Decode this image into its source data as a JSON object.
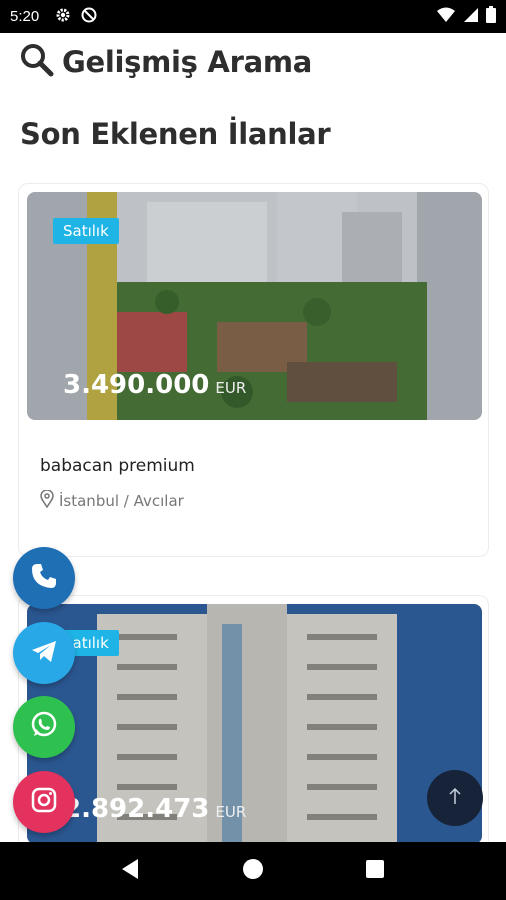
{
  "status_bar": {
    "time": "5:20",
    "left_icons": [
      "gear-icon",
      "do-not-disturb-icon"
    ],
    "right_icons": [
      "wifi-icon",
      "cell-signal-icon",
      "battery-icon"
    ]
  },
  "search": {
    "label": "Gelişmiş Arama",
    "icon": "search-icon"
  },
  "section": {
    "title": "Son Eklenen İlanlar"
  },
  "listings": [
    {
      "badge": "Satılık",
      "price": "3.490.000",
      "currency": "EUR",
      "title": "babacan premium",
      "location": "İstanbul / Avcılar"
    },
    {
      "badge": "Satılık",
      "price": "2.892.473",
      "currency": "EUR"
    }
  ],
  "floating_buttons": [
    "phone-icon",
    "telegram-icon",
    "whatsapp-icon",
    "instagram-icon"
  ],
  "scroll_top": {
    "icon": "arrow-up-icon"
  },
  "nav_bar": {
    "icons": [
      "back-icon",
      "home-icon",
      "recents-icon"
    ]
  },
  "colors": {
    "badge": "#1fb4e6",
    "phone": "#1f6fb5",
    "telegram": "#29a8e8",
    "whatsapp": "#2fc14f",
    "instagram": "#e2325d",
    "scroll_top": "#162338"
  }
}
